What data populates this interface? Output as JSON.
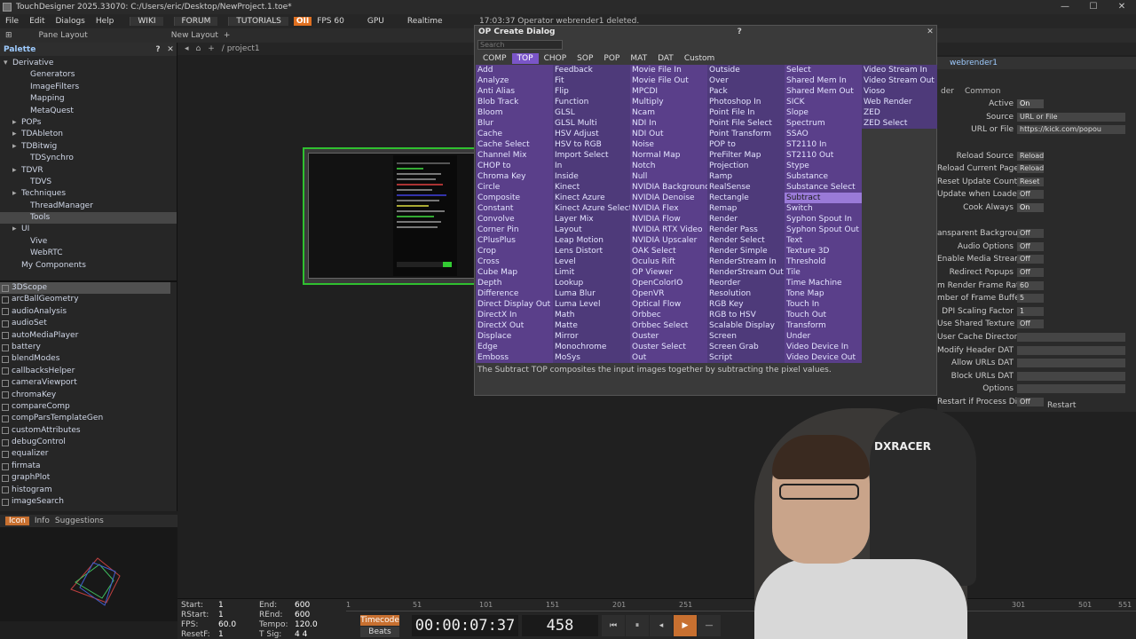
{
  "titlebar": {
    "title": "TouchDesigner 2025.33070: C:/Users/eric/Desktop/NewProject.1.toe*"
  },
  "menubar": {
    "menus": [
      "File",
      "Edit",
      "Dialogs",
      "Help"
    ],
    "tabs": [
      "WIKI",
      "FORUM",
      "TUTORIALS"
    ],
    "perf": "OII",
    "fps": "FPS  60",
    "gpu": "GPU",
    "realtime": "Realtime",
    "status": "17:03:37 Operator webrender1 deleted."
  },
  "toolbar": {
    "pane_layout": "Pane Layout",
    "new_layout": "New Layout",
    "path": "/ project1"
  },
  "palette": {
    "title": "Palette",
    "tree": [
      {
        "label": "Derivative",
        "arrow": "▾",
        "indent": 0
      },
      {
        "label": "Generators",
        "arrow": "",
        "indent": 2
      },
      {
        "label": "ImageFilters",
        "arrow": "",
        "indent": 2
      },
      {
        "label": "Mapping",
        "arrow": "",
        "indent": 2
      },
      {
        "label": "MetaQuest",
        "arrow": "",
        "indent": 2
      },
      {
        "label": "POPs",
        "arrow": "▸",
        "indent": 1
      },
      {
        "label": "TDAbleton",
        "arrow": "▸",
        "indent": 1
      },
      {
        "label": "TDBitwig",
        "arrow": "▸",
        "indent": 1
      },
      {
        "label": "TDSynchro",
        "arrow": "",
        "indent": 2
      },
      {
        "label": "TDVR",
        "arrow": "▸",
        "indent": 1
      },
      {
        "label": "TDVS",
        "arrow": "",
        "indent": 2
      },
      {
        "label": "Techniques",
        "arrow": "▸",
        "indent": 1
      },
      {
        "label": "ThreadManager",
        "arrow": "",
        "indent": 2
      },
      {
        "label": "Tools",
        "arrow": "",
        "indent": 2,
        "sel": true
      },
      {
        "label": "UI",
        "arrow": "▸",
        "indent": 1
      },
      {
        "label": "Vive",
        "arrow": "",
        "indent": 2
      },
      {
        "label": "WebRTC",
        "arrow": "",
        "indent": 2
      },
      {
        "label": "My Components",
        "arrow": "",
        "indent": 1
      }
    ],
    "items": [
      "3DScope",
      "arcBallGeometry",
      "audioAnalysis",
      "audioSet",
      "autoMediaPlayer",
      "battery",
      "blendModes",
      "callbacksHelper",
      "cameraViewport",
      "chromaKey",
      "compareComp",
      "compParsTemplateGen",
      "customAttributes",
      "debugControl",
      "equalizer",
      "firmata",
      "graphPlot",
      "histogram",
      "imageSearch"
    ],
    "preview_tabs": [
      "Icon",
      "Info",
      "Suggestions"
    ]
  },
  "dialog": {
    "title": "OP Create Dialog",
    "search_placeholder": "Search",
    "tabs": [
      "COMP",
      "TOP",
      "CHOP",
      "SOP",
      "POP",
      "MAT",
      "DAT",
      "Custom"
    ],
    "columns": [
      [
        "Add",
        "Analyze",
        "Anti Alias",
        "Blob Track",
        "Bloom",
        "Blur",
        "Cache",
        "Cache Select",
        "Channel Mix",
        "CHOP to",
        "Chroma Key",
        "Circle",
        "Composite",
        "Constant",
        "Convolve",
        "Corner Pin",
        "CPlusPlus",
        "Crop",
        "Cross",
        "Cube Map",
        "Depth",
        "Difference",
        "Direct Display Out",
        "DirectX In",
        "DirectX Out",
        "Displace",
        "Edge",
        "Emboss"
      ],
      [
        "Feedback",
        "Fit",
        "Flip",
        "Function",
        "GLSL",
        "GLSL Multi",
        "HSV Adjust",
        "HSV to RGB",
        "Import Select",
        "In",
        "Inside",
        "Kinect",
        "Kinect Azure",
        "Kinect Azure Select",
        "Layer Mix",
        "Layout",
        "Leap Motion",
        "Lens Distort",
        "Level",
        "Limit",
        "Lookup",
        "Luma Blur",
        "Luma Level",
        "Math",
        "Matte",
        "Mirror",
        "Monochrome",
        "MoSys"
      ],
      [
        "Movie File In",
        "Movie File Out",
        "MPCDI",
        "Multiply",
        "Ncam",
        "NDI In",
        "NDI Out",
        "Noise",
        "Normal Map",
        "Notch",
        "Null",
        "NVIDIA Background",
        "NVIDIA Denoise",
        "NVIDIA Flex",
        "NVIDIA Flow",
        "NVIDIA RTX Video",
        "NVIDIA Upscaler",
        "OAK Select",
        "Oculus Rift",
        "OP Viewer",
        "OpenColorIO",
        "OpenVR",
        "Optical Flow",
        "Orbbec",
        "Orbbec Select",
        "Ouster",
        "Ouster Select",
        "Out"
      ],
      [
        "Outside",
        "Over",
        "Pack",
        "Photoshop In",
        "Point File In",
        "Point File Select",
        "Point Transform",
        "POP to",
        "PreFilter Map",
        "Projection",
        "Ramp",
        "RealSense",
        "Rectangle",
        "Remap",
        "Render",
        "Render Pass",
        "Render Select",
        "Render Simple",
        "RenderStream In",
        "RenderStream Out",
        "Reorder",
        "Resolution",
        "RGB Key",
        "RGB to HSV",
        "Scalable Display",
        "Screen",
        "Screen Grab",
        "Script"
      ],
      [
        "Select",
        "Shared Mem In",
        "Shared Mem Out",
        "SICK",
        "Slope",
        "Spectrum",
        "SSAO",
        "ST2110 In",
        "ST2110 Out",
        "Stype",
        "Substance",
        "Substance Select",
        "Subtract",
        "Switch",
        "Syphon Spout In",
        "Syphon Spout Out",
        "Text",
        "Texture 3D",
        "Threshold",
        "Tile",
        "Time Machine",
        "Tone Map",
        "Touch In",
        "Touch Out",
        "Transform",
        "Under",
        "Video Device In",
        "Video Device Out"
      ],
      [
        "Video Stream In",
        "Video Stream Out",
        "Vioso",
        "Web Render",
        "ZED",
        "ZED Select"
      ]
    ],
    "highlight": "Subtract",
    "description": "The Subtract TOP composites the input images together by subtracting the pixel values."
  },
  "params": {
    "op_name": "webrender1",
    "tabs": [
      "der",
      "Common"
    ],
    "rows": [
      {
        "label": "Active",
        "value": "On"
      },
      {
        "label": "Source",
        "value": "URL or File"
      },
      {
        "label": "URL or File",
        "value": "https://kick.com/popou"
      },
      {
        "label": "",
        "value": ""
      },
      {
        "label": "Reload Source",
        "value": "Reload"
      },
      {
        "label": "Reload Current Page",
        "value": "Reload"
      },
      {
        "label": "Reset Update Count",
        "value": "Reset"
      },
      {
        "label": "Update when Loaded",
        "value": "Off"
      },
      {
        "label": "Cook Always",
        "value": "On"
      },
      {
        "label": "",
        "value": ""
      },
      {
        "label": "ansparent Background",
        "value": "Off"
      },
      {
        "label": "Audio Options",
        "value": "Off"
      },
      {
        "label": "Enable Media Stream",
        "value": "Off"
      },
      {
        "label": "Redirect Popups",
        "value": "Off"
      },
      {
        "label": "m Render Frame Rate",
        "value": "60"
      },
      {
        "label": "mber of Frame Buffers",
        "value": "5"
      },
      {
        "label": "DPI Scaling Factor",
        "value": "1"
      },
      {
        "label": "Use Shared Texture",
        "value": "Off"
      },
      {
        "label": "User Cache Directory",
        "value": ""
      },
      {
        "label": "Modify Header DAT",
        "value": ""
      },
      {
        "label": "Allow URLs DAT",
        "value": ""
      },
      {
        "label": "Block URLs DAT",
        "value": ""
      },
      {
        "label": "Options",
        "value": ""
      },
      {
        "label": "Restart if Process Died",
        "value": "Off"
      }
    ],
    "restart_label": "Restart"
  },
  "timeline": {
    "start_label": "Start:",
    "start": "1",
    "rstart_label": "RStart:",
    "rstart": "1",
    "fps_label": "FPS:",
    "fps": "60.0",
    "resetf_label": "ResetF:",
    "resetf": "1",
    "end_label": "End:",
    "end": "600",
    "rend_label": "REnd:",
    "rend": "600",
    "tempo_label": "Tempo:",
    "tempo": "120.0",
    "tsig_label": "T Sig:",
    "tsig": "4    4",
    "timecode_btn": "Timecode",
    "beats_btn": "Beats",
    "time": "00:00:07:37",
    "frame": "458",
    "ruler": [
      "1",
      "51",
      "101",
      "151",
      "201",
      "251",
      "301",
      "501",
      "551"
    ]
  },
  "webcam": {
    "brand": "DXRACER"
  }
}
